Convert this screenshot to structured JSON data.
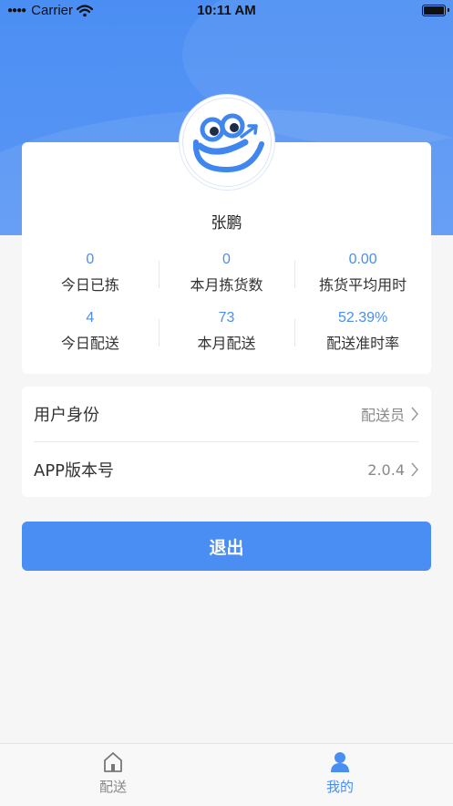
{
  "status_bar": {
    "carrier": "Carrier",
    "time": "10:11 AM"
  },
  "profile": {
    "name": "张鹏"
  },
  "stats": [
    {
      "value": "0",
      "label": "今日已拣"
    },
    {
      "value": "0",
      "label": "本月拣货数"
    },
    {
      "value": "0.00",
      "label": "拣货平均用时"
    },
    {
      "value": "4",
      "label": "今日配送"
    },
    {
      "value": "73",
      "label": "本月配送"
    },
    {
      "value": "52.39%",
      "label": "配送准时率"
    }
  ],
  "settings": {
    "role_label": "用户身份",
    "role_value": "配送员",
    "version_label": "APP版本号",
    "version_value": "2.0.4"
  },
  "logout_label": "退出",
  "tabs": [
    {
      "label": "配送",
      "icon": "home-icon",
      "active": false
    },
    {
      "label": "我的",
      "icon": "user-icon",
      "active": true
    }
  ],
  "colors": {
    "accent": "#4a8ef2",
    "header": "#4b8ef3"
  }
}
